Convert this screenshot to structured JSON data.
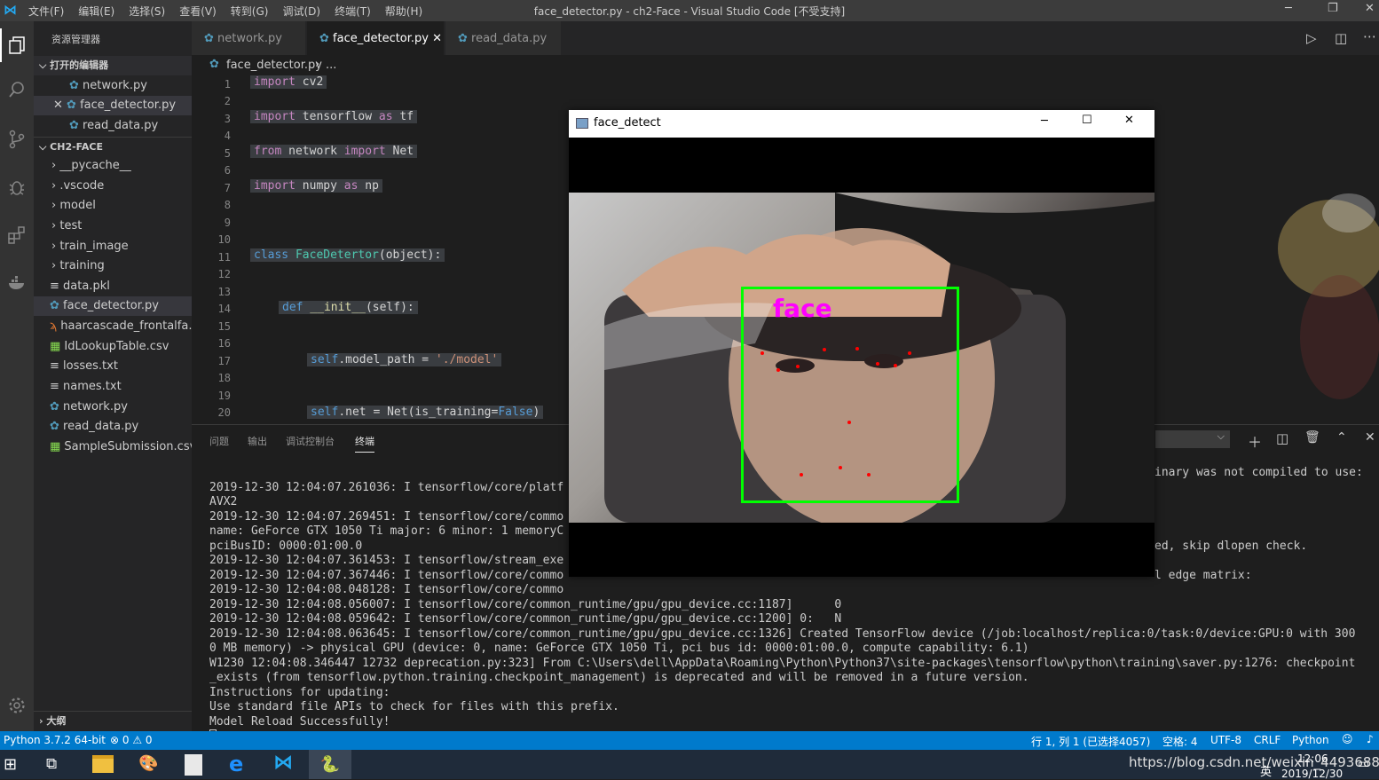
{
  "titlebar": {
    "menu": [
      "文件(F)",
      "编辑(E)",
      "选择(S)",
      "查看(V)",
      "转到(G)",
      "调试(D)",
      "终端(T)",
      "帮助(H)"
    ],
    "title": "face_detector.py - ch2-Face - Visual Studio Code [不受支持]"
  },
  "sidebar": {
    "header": "资源管理器",
    "open_editors_label": "打开的编辑器",
    "open_editors": [
      "network.py",
      "face_detector.py",
      "read_data.py"
    ],
    "project_label": "CH2-FACE",
    "folders": [
      "__pycache__",
      ".vscode",
      "model",
      "test",
      "train_image",
      "training"
    ],
    "files": [
      "data.pkl",
      "face_detector.py",
      "haarcascade_frontalfa...",
      "IdLookupTable.csv",
      "losses.txt",
      "names.txt",
      "network.py",
      "read_data.py",
      "SampleSubmission.csv"
    ],
    "outline_label": "大纲"
  },
  "tabs": [
    "network.py",
    "face_detector.py",
    "read_data.py"
  ],
  "breadcrumb": {
    "file": "face_detector.py",
    "rest": "..."
  },
  "line_numbers": [
    "1",
    "2",
    "3",
    "4",
    "5",
    "6",
    "7",
    "8",
    "9",
    "10",
    "11",
    "12",
    "13",
    "14",
    "15",
    "16",
    "17",
    "18",
    "19",
    "20"
  ],
  "code": {
    "l1a": "import",
    "l1b": " cv2",
    "l3a": "import",
    "l3b": " tensorflow ",
    "l3c": "as",
    "l3d": " tf",
    "l5a": "from",
    "l5b": " network ",
    "l5c": "import",
    "l5d": " Net",
    "l7a": "import",
    "l7b": " numpy ",
    "l7c": "as",
    "l7d": " np",
    "l11a": "class",
    "l11b": " FaceDetertor",
    "l11c": "(object):",
    "l14a": "def",
    "l14b": " __init__",
    "l14c": "(self):",
    "l17a": "self",
    "l17b": ".model_path = ",
    "l17c": "'./model'",
    "l20a": "self",
    "l20b": ".net = Net(is_training=",
    "l20c": "False",
    ")": ")"
  },
  "panel_tabs": [
    "问题",
    "输出",
    "调试控制台",
    "终端"
  ],
  "terminal_lines": [
    "2019-12-30 12:04:07.261036: I tensorflow/core/platf",
    "AVX2",
    "2019-12-30 12:04:07.269451: I tensorflow/core/commo",
    "name: GeForce GTX 1050 Ti major: 6 minor: 1 memoryC",
    "pciBusID: 0000:01:00.0",
    "2019-12-30 12:04:07.361453: I tensorflow/stream_exe",
    "2019-12-30 12:04:07.367446: I tensorflow/core/commo",
    "2019-12-30 12:04:08.048128: I tensorflow/core/commo",
    "2019-12-30 12:04:08.056007: I tensorflow/core/common_runtime/gpu/gpu_device.cc:1187]      0",
    "2019-12-30 12:04:08.059642: I tensorflow/core/common_runtime/gpu/gpu_device.cc:1200] 0:   N",
    "2019-12-30 12:04:08.063645: I tensorflow/core/common_runtime/gpu/gpu_device.cc:1326] Created TensorFlow device (/job:localhost/replica:0/task:0/device:GPU:0 with 300",
    "0 MB memory) -> physical GPU (device: 0, name: GeForce GTX 1050 Ti, pci bus id: 0000:01:00.0, compute capability: 6.1)",
    "W1230 12:04:08.346447 12732 deprecation.py:323] From C:\\Users\\dell\\AppData\\Roaming\\Python\\Python37\\site-packages\\tensorflow\\python\\training\\saver.py:1276: checkpoint",
    "_exists (from tensorflow.python.training.checkpoint_management) is deprecated and will be removed in a future version.",
    "Instructions for updating:",
    "Use standard file APIs to check for files with this prefix.",
    "Model Reload Successfully!"
  ],
  "terminal_right": {
    "r1": "inary was not compiled to use:",
    "r2": "ed, skip dlopen check.",
    "r3": "l edge matrix:"
  },
  "statusbar": {
    "python": "Python 3.7.2 64-bit",
    "problems": "⊗ 0 ⚠ 0",
    "position": "行 1, 列 1 (已选择4057)",
    "spaces": "空格: 4",
    "encoding": "UTF-8",
    "eol": "CRLF",
    "language": "Python"
  },
  "cv_window": {
    "title": "face_detect",
    "label": "face",
    "box_color": "#00ff00",
    "label_color": "#ff00ff"
  },
  "taskbar": {
    "watermark": "https://blog.csdn.net/weixin_44936889",
    "time": "12:06",
    "date": "2019/12/30",
    "ime": "英"
  }
}
